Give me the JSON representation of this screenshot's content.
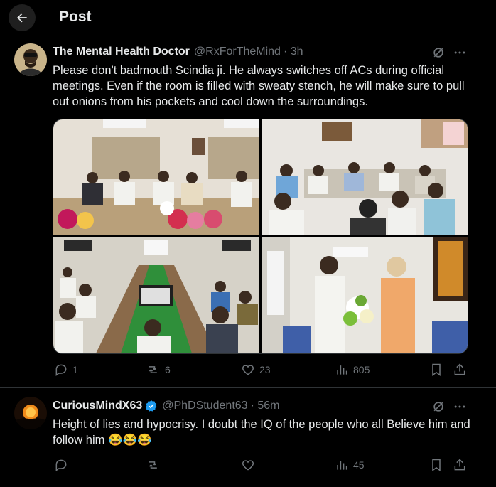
{
  "header": {
    "title": "Post"
  },
  "posts": [
    {
      "name": "The Mental Health Doctor",
      "handle": "@RxForTheMind",
      "time": "· 3h",
      "text": "Please don't badmouth Scindia ji. He always switches off ACs during official meetings. Even if the room is filled with sweaty stench, he will make sure to pull out onions from his pockets and cool down the surroundings.",
      "counts": {
        "replies": "1",
        "reposts": "6",
        "likes": "23",
        "views": "805"
      }
    },
    {
      "name": "CuriousMindX63",
      "handle": "@PhDStudent63",
      "time": "· 56m",
      "text": "Height of lies and hypocrisy. I doubt the IQ of the people who all Believe him and follow him 😂😂😂",
      "counts": {
        "replies": "",
        "reposts": "",
        "likes": "",
        "views": "45"
      }
    }
  ]
}
